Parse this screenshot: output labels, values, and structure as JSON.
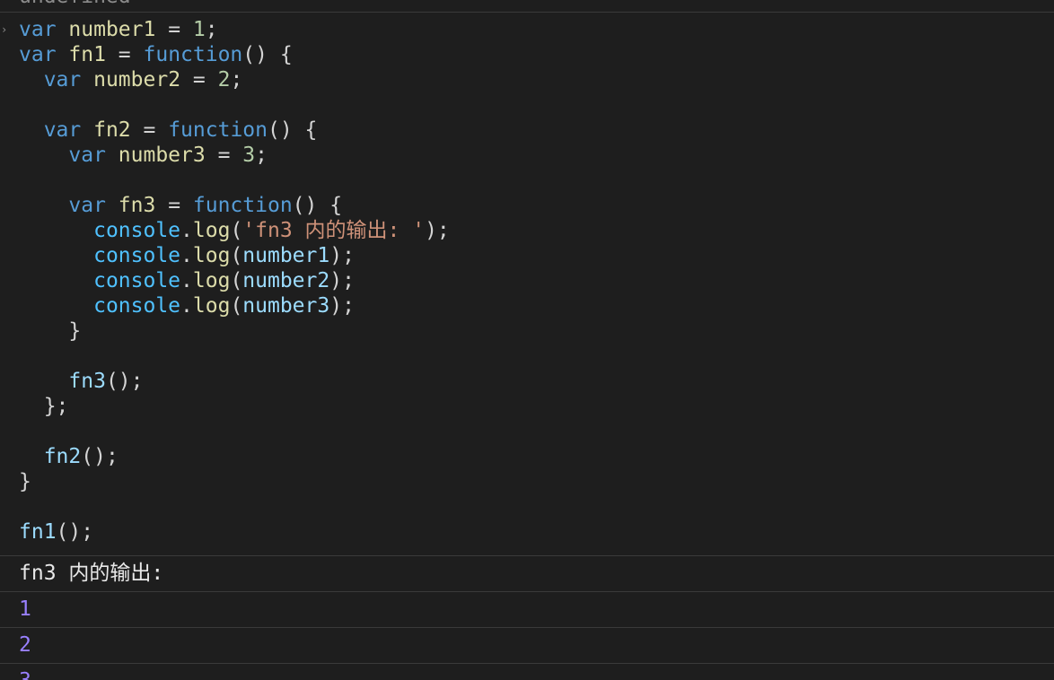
{
  "console": {
    "previous_output": "undefined",
    "input_caret": "›"
  },
  "code_lines": [
    [
      {
        "c": "kw",
        "t": "var"
      },
      {
        "c": "pun",
        "t": " "
      },
      {
        "c": "var",
        "t": "number1"
      },
      {
        "c": "pun",
        "t": " = "
      },
      {
        "c": "num",
        "t": "1"
      },
      {
        "c": "pun",
        "t": ";"
      }
    ],
    [
      {
        "c": "kw",
        "t": "var"
      },
      {
        "c": "pun",
        "t": " "
      },
      {
        "c": "var",
        "t": "fn1"
      },
      {
        "c": "pun",
        "t": " = "
      },
      {
        "c": "kw",
        "t": "function"
      },
      {
        "c": "pun",
        "t": "() {"
      }
    ],
    [
      {
        "c": "pun",
        "t": "  "
      },
      {
        "c": "kw",
        "t": "var"
      },
      {
        "c": "pun",
        "t": " "
      },
      {
        "c": "var",
        "t": "number2"
      },
      {
        "c": "pun",
        "t": " = "
      },
      {
        "c": "num",
        "t": "2"
      },
      {
        "c": "pun",
        "t": ";"
      }
    ],
    [],
    [
      {
        "c": "pun",
        "t": "  "
      },
      {
        "c": "kw",
        "t": "var"
      },
      {
        "c": "pun",
        "t": " "
      },
      {
        "c": "var",
        "t": "fn2"
      },
      {
        "c": "pun",
        "t": " = "
      },
      {
        "c": "kw",
        "t": "function"
      },
      {
        "c": "pun",
        "t": "() {"
      }
    ],
    [
      {
        "c": "pun",
        "t": "    "
      },
      {
        "c": "kw",
        "t": "var"
      },
      {
        "c": "pun",
        "t": " "
      },
      {
        "c": "var",
        "t": "number3"
      },
      {
        "c": "pun",
        "t": " = "
      },
      {
        "c": "num",
        "t": "3"
      },
      {
        "c": "pun",
        "t": ";"
      }
    ],
    [],
    [
      {
        "c": "pun",
        "t": "    "
      },
      {
        "c": "kw",
        "t": "var"
      },
      {
        "c": "pun",
        "t": " "
      },
      {
        "c": "var",
        "t": "fn3"
      },
      {
        "c": "pun",
        "t": " = "
      },
      {
        "c": "kw",
        "t": "function"
      },
      {
        "c": "pun",
        "t": "() {"
      }
    ],
    [
      {
        "c": "pun",
        "t": "      "
      },
      {
        "c": "obj",
        "t": "console"
      },
      {
        "c": "pun",
        "t": "."
      },
      {
        "c": "var",
        "t": "log"
      },
      {
        "c": "pun",
        "t": "("
      },
      {
        "c": "str",
        "t": "'fn3 内的输出: '"
      },
      {
        "c": "pun",
        "t": ");"
      }
    ],
    [
      {
        "c": "pun",
        "t": "      "
      },
      {
        "c": "obj",
        "t": "console"
      },
      {
        "c": "pun",
        "t": "."
      },
      {
        "c": "var",
        "t": "log"
      },
      {
        "c": "pun",
        "t": "("
      },
      {
        "c": "fn",
        "t": "number1"
      },
      {
        "c": "pun",
        "t": ");"
      }
    ],
    [
      {
        "c": "pun",
        "t": "      "
      },
      {
        "c": "obj",
        "t": "console"
      },
      {
        "c": "pun",
        "t": "."
      },
      {
        "c": "var",
        "t": "log"
      },
      {
        "c": "pun",
        "t": "("
      },
      {
        "c": "fn",
        "t": "number2"
      },
      {
        "c": "pun",
        "t": ");"
      }
    ],
    [
      {
        "c": "pun",
        "t": "      "
      },
      {
        "c": "obj",
        "t": "console"
      },
      {
        "c": "pun",
        "t": "."
      },
      {
        "c": "var",
        "t": "log"
      },
      {
        "c": "pun",
        "t": "("
      },
      {
        "c": "fn",
        "t": "number3"
      },
      {
        "c": "pun",
        "t": ");"
      }
    ],
    [
      {
        "c": "pun",
        "t": "    }"
      }
    ],
    [],
    [
      {
        "c": "pun",
        "t": "    "
      },
      {
        "c": "fn",
        "t": "fn3"
      },
      {
        "c": "pun",
        "t": "();"
      }
    ],
    [
      {
        "c": "pun",
        "t": "  };"
      }
    ],
    [],
    [
      {
        "c": "pun",
        "t": "  "
      },
      {
        "c": "fn",
        "t": "fn2"
      },
      {
        "c": "pun",
        "t": "();"
      }
    ],
    [
      {
        "c": "pun",
        "t": "}"
      }
    ],
    [],
    [
      {
        "c": "fn",
        "t": "fn1"
      },
      {
        "c": "pun",
        "t": "();"
      }
    ]
  ],
  "output_rows": [
    {
      "kind": "text",
      "value": "fn3 内的输出: "
    },
    {
      "kind": "number",
      "value": "1"
    },
    {
      "kind": "number",
      "value": "2"
    },
    {
      "kind": "number",
      "value": "3"
    }
  ]
}
